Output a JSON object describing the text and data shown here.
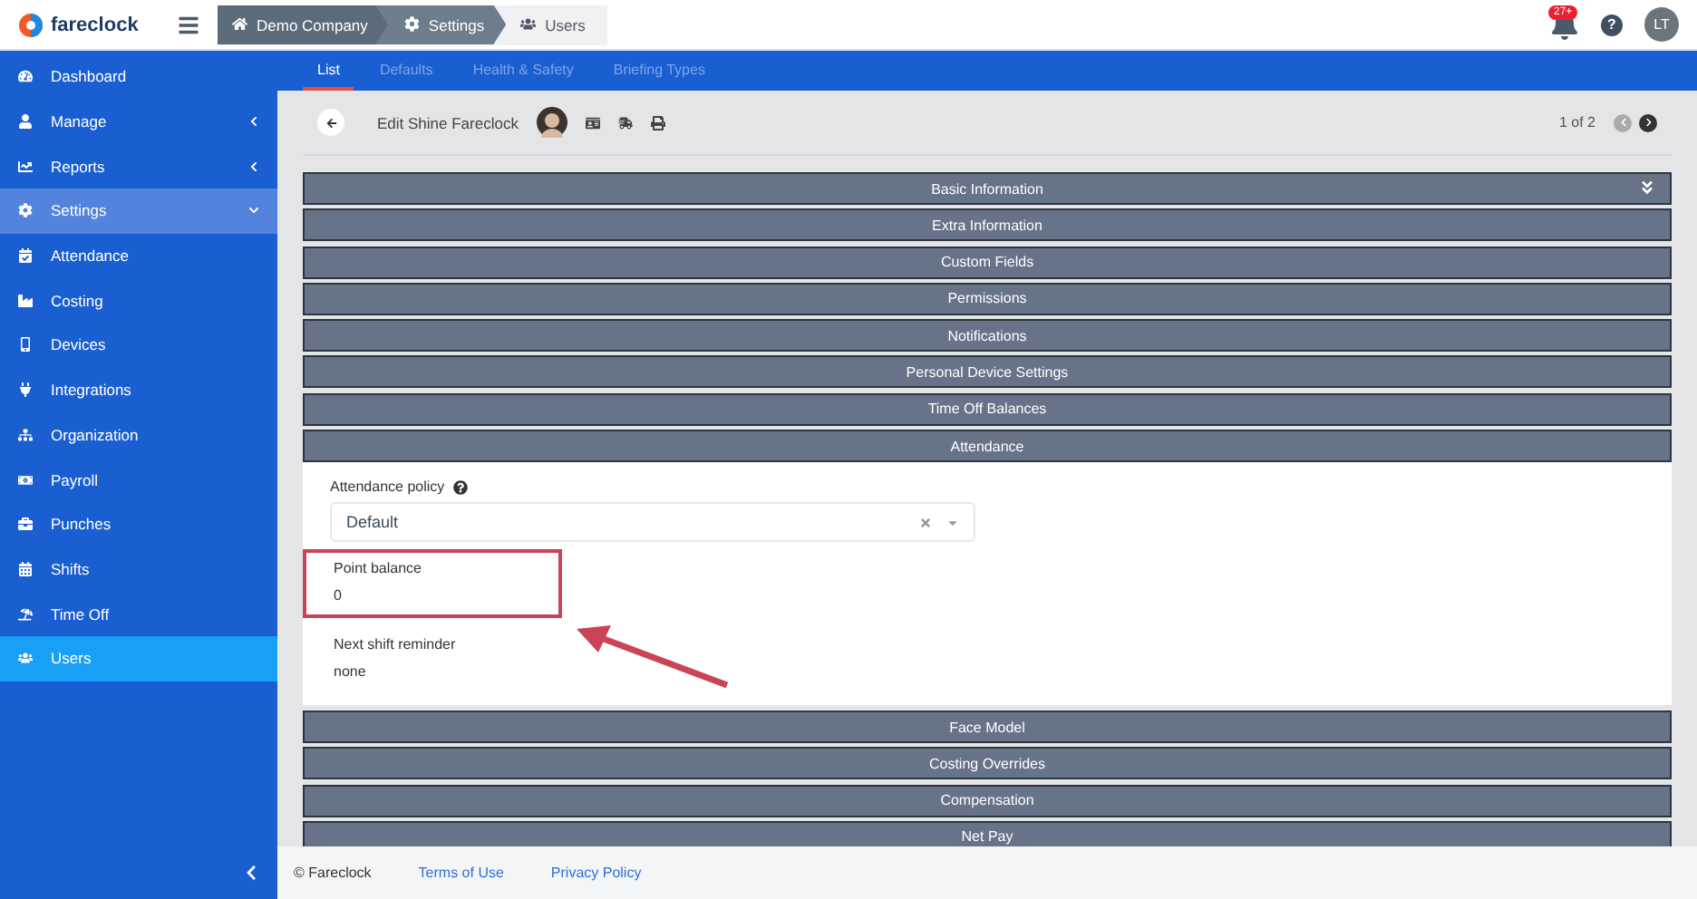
{
  "app": {
    "logo": "fareclock"
  },
  "breadcrumb": [
    {
      "label": "Demo Company",
      "kind": "home"
    },
    {
      "label": "Settings",
      "kind": "settings"
    },
    {
      "label": "Users",
      "kind": "users"
    }
  ],
  "header": {
    "notification_count": "27+",
    "help": "?",
    "user_initials": "LT"
  },
  "sidebar": {
    "items": [
      {
        "label": "Dashboard",
        "selected": false
      },
      {
        "label": "Manage",
        "selected": false,
        "expanded": false
      },
      {
        "label": "Reports",
        "selected": false,
        "expanded": false
      },
      {
        "label": "Settings",
        "selected": false,
        "expanded": true,
        "children": [
          {
            "label": "Attendance",
            "selected": false
          },
          {
            "label": "Costing",
            "selected": false
          },
          {
            "label": "Devices",
            "selected": false
          },
          {
            "label": "Integrations",
            "selected": false
          },
          {
            "label": "Organization",
            "selected": false
          },
          {
            "label": "Payroll",
            "selected": false
          },
          {
            "label": "Punches",
            "selected": false
          },
          {
            "label": "Shifts",
            "selected": false
          },
          {
            "label": "Time Off",
            "selected": false
          },
          {
            "label": "Users",
            "selected": true
          }
        ]
      }
    ]
  },
  "tabs": [
    {
      "label": "List",
      "selected": true
    },
    {
      "label": "Defaults",
      "selected": false
    },
    {
      "label": "Health & Safety",
      "selected": false
    },
    {
      "label": "Briefing Types",
      "selected": false
    }
  ],
  "record": {
    "title": "Edit Shine Fareclock",
    "pager": "1 of 2",
    "prev_disabled": true,
    "next_disabled": false
  },
  "sections": [
    {
      "label": "Basic Information",
      "expanded": false
    },
    {
      "label": "Extra Information",
      "expanded": false
    },
    {
      "label": "Custom Fields",
      "expanded": false
    },
    {
      "label": "Permissions",
      "expanded": false
    },
    {
      "label": "Notifications",
      "expanded": false
    },
    {
      "label": "Personal Device Settings",
      "expanded": false
    },
    {
      "label": "Time Off Balances",
      "expanded": false
    },
    {
      "label": "Attendance",
      "expanded": true
    },
    {
      "label": "Face Model",
      "expanded": false
    },
    {
      "label": "Costing Overrides",
      "expanded": false
    },
    {
      "label": "Compensation",
      "expanded": false
    },
    {
      "label": "Net Pay",
      "expanded": false
    }
  ],
  "attendance": {
    "policy_label": "Attendance policy",
    "policy_value": "Default",
    "fields": [
      {
        "label": "Point balance",
        "value": "0",
        "highlighted": true
      },
      {
        "label": "Next shift reminder",
        "value": "none",
        "highlighted": false
      }
    ]
  },
  "footer": {
    "copyright": "© Fareclock",
    "links": [
      "Terms of Use",
      "Privacy Policy"
    ]
  }
}
